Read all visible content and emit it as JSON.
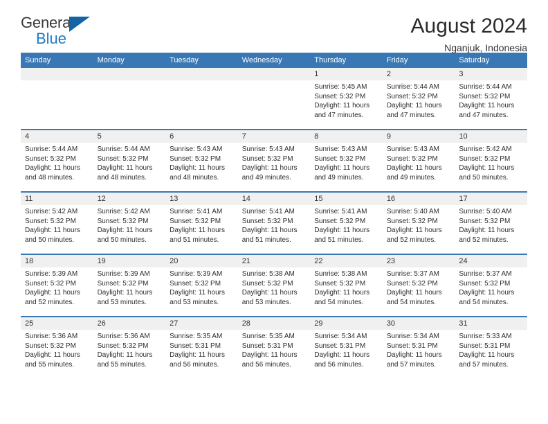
{
  "brand": {
    "name_top": "General",
    "name_bottom": "Blue",
    "accent_color": "#1464a5",
    "blue_text_color": "#1e7ac4"
  },
  "header": {
    "title": "August 2024",
    "location": "Nganjuk, Indonesia",
    "header_bg": "#3a78b5",
    "daynum_bg": "#f0f0f0"
  },
  "weekday_headers": [
    "Sunday",
    "Monday",
    "Tuesday",
    "Wednesday",
    "Thursday",
    "Friday",
    "Saturday"
  ],
  "calendar": {
    "weeks": [
      [
        {
          "day": "",
          "empty": true,
          "sunrise": "",
          "sunset": "",
          "daylight1": "",
          "daylight2": ""
        },
        {
          "day": "",
          "empty": true,
          "sunrise": "",
          "sunset": "",
          "daylight1": "",
          "daylight2": ""
        },
        {
          "day": "",
          "empty": true,
          "sunrise": "",
          "sunset": "",
          "daylight1": "",
          "daylight2": ""
        },
        {
          "day": "",
          "empty": true,
          "sunrise": "",
          "sunset": "",
          "daylight1": "",
          "daylight2": ""
        },
        {
          "day": "1",
          "empty": false,
          "sunrise": "Sunrise: 5:45 AM",
          "sunset": "Sunset: 5:32 PM",
          "daylight1": "Daylight: 11 hours",
          "daylight2": "and 47 minutes."
        },
        {
          "day": "2",
          "empty": false,
          "sunrise": "Sunrise: 5:44 AM",
          "sunset": "Sunset: 5:32 PM",
          "daylight1": "Daylight: 11 hours",
          "daylight2": "and 47 minutes."
        },
        {
          "day": "3",
          "empty": false,
          "sunrise": "Sunrise: 5:44 AM",
          "sunset": "Sunset: 5:32 PM",
          "daylight1": "Daylight: 11 hours",
          "daylight2": "and 47 minutes."
        }
      ],
      [
        {
          "day": "4",
          "empty": false,
          "sunrise": "Sunrise: 5:44 AM",
          "sunset": "Sunset: 5:32 PM",
          "daylight1": "Daylight: 11 hours",
          "daylight2": "and 48 minutes."
        },
        {
          "day": "5",
          "empty": false,
          "sunrise": "Sunrise: 5:44 AM",
          "sunset": "Sunset: 5:32 PM",
          "daylight1": "Daylight: 11 hours",
          "daylight2": "and 48 minutes."
        },
        {
          "day": "6",
          "empty": false,
          "sunrise": "Sunrise: 5:43 AM",
          "sunset": "Sunset: 5:32 PM",
          "daylight1": "Daylight: 11 hours",
          "daylight2": "and 48 minutes."
        },
        {
          "day": "7",
          "empty": false,
          "sunrise": "Sunrise: 5:43 AM",
          "sunset": "Sunset: 5:32 PM",
          "daylight1": "Daylight: 11 hours",
          "daylight2": "and 49 minutes."
        },
        {
          "day": "8",
          "empty": false,
          "sunrise": "Sunrise: 5:43 AM",
          "sunset": "Sunset: 5:32 PM",
          "daylight1": "Daylight: 11 hours",
          "daylight2": "and 49 minutes."
        },
        {
          "day": "9",
          "empty": false,
          "sunrise": "Sunrise: 5:43 AM",
          "sunset": "Sunset: 5:32 PM",
          "daylight1": "Daylight: 11 hours",
          "daylight2": "and 49 minutes."
        },
        {
          "day": "10",
          "empty": false,
          "sunrise": "Sunrise: 5:42 AM",
          "sunset": "Sunset: 5:32 PM",
          "daylight1": "Daylight: 11 hours",
          "daylight2": "and 50 minutes."
        }
      ],
      [
        {
          "day": "11",
          "empty": false,
          "sunrise": "Sunrise: 5:42 AM",
          "sunset": "Sunset: 5:32 PM",
          "daylight1": "Daylight: 11 hours",
          "daylight2": "and 50 minutes."
        },
        {
          "day": "12",
          "empty": false,
          "sunrise": "Sunrise: 5:42 AM",
          "sunset": "Sunset: 5:32 PM",
          "daylight1": "Daylight: 11 hours",
          "daylight2": "and 50 minutes."
        },
        {
          "day": "13",
          "empty": false,
          "sunrise": "Sunrise: 5:41 AM",
          "sunset": "Sunset: 5:32 PM",
          "daylight1": "Daylight: 11 hours",
          "daylight2": "and 51 minutes."
        },
        {
          "day": "14",
          "empty": false,
          "sunrise": "Sunrise: 5:41 AM",
          "sunset": "Sunset: 5:32 PM",
          "daylight1": "Daylight: 11 hours",
          "daylight2": "and 51 minutes."
        },
        {
          "day": "15",
          "empty": false,
          "sunrise": "Sunrise: 5:41 AM",
          "sunset": "Sunset: 5:32 PM",
          "daylight1": "Daylight: 11 hours",
          "daylight2": "and 51 minutes."
        },
        {
          "day": "16",
          "empty": false,
          "sunrise": "Sunrise: 5:40 AM",
          "sunset": "Sunset: 5:32 PM",
          "daylight1": "Daylight: 11 hours",
          "daylight2": "and 52 minutes."
        },
        {
          "day": "17",
          "empty": false,
          "sunrise": "Sunrise: 5:40 AM",
          "sunset": "Sunset: 5:32 PM",
          "daylight1": "Daylight: 11 hours",
          "daylight2": "and 52 minutes."
        }
      ],
      [
        {
          "day": "18",
          "empty": false,
          "sunrise": "Sunrise: 5:39 AM",
          "sunset": "Sunset: 5:32 PM",
          "daylight1": "Daylight: 11 hours",
          "daylight2": "and 52 minutes."
        },
        {
          "day": "19",
          "empty": false,
          "sunrise": "Sunrise: 5:39 AM",
          "sunset": "Sunset: 5:32 PM",
          "daylight1": "Daylight: 11 hours",
          "daylight2": "and 53 minutes."
        },
        {
          "day": "20",
          "empty": false,
          "sunrise": "Sunrise: 5:39 AM",
          "sunset": "Sunset: 5:32 PM",
          "daylight1": "Daylight: 11 hours",
          "daylight2": "and 53 minutes."
        },
        {
          "day": "21",
          "empty": false,
          "sunrise": "Sunrise: 5:38 AM",
          "sunset": "Sunset: 5:32 PM",
          "daylight1": "Daylight: 11 hours",
          "daylight2": "and 53 minutes."
        },
        {
          "day": "22",
          "empty": false,
          "sunrise": "Sunrise: 5:38 AM",
          "sunset": "Sunset: 5:32 PM",
          "daylight1": "Daylight: 11 hours",
          "daylight2": "and 54 minutes."
        },
        {
          "day": "23",
          "empty": false,
          "sunrise": "Sunrise: 5:37 AM",
          "sunset": "Sunset: 5:32 PM",
          "daylight1": "Daylight: 11 hours",
          "daylight2": "and 54 minutes."
        },
        {
          "day": "24",
          "empty": false,
          "sunrise": "Sunrise: 5:37 AM",
          "sunset": "Sunset: 5:32 PM",
          "daylight1": "Daylight: 11 hours",
          "daylight2": "and 54 minutes."
        }
      ],
      [
        {
          "day": "25",
          "empty": false,
          "sunrise": "Sunrise: 5:36 AM",
          "sunset": "Sunset: 5:32 PM",
          "daylight1": "Daylight: 11 hours",
          "daylight2": "and 55 minutes."
        },
        {
          "day": "26",
          "empty": false,
          "sunrise": "Sunrise: 5:36 AM",
          "sunset": "Sunset: 5:32 PM",
          "daylight1": "Daylight: 11 hours",
          "daylight2": "and 55 minutes."
        },
        {
          "day": "27",
          "empty": false,
          "sunrise": "Sunrise: 5:35 AM",
          "sunset": "Sunset: 5:31 PM",
          "daylight1": "Daylight: 11 hours",
          "daylight2": "and 56 minutes."
        },
        {
          "day": "28",
          "empty": false,
          "sunrise": "Sunrise: 5:35 AM",
          "sunset": "Sunset: 5:31 PM",
          "daylight1": "Daylight: 11 hours",
          "daylight2": "and 56 minutes."
        },
        {
          "day": "29",
          "empty": false,
          "sunrise": "Sunrise: 5:34 AM",
          "sunset": "Sunset: 5:31 PM",
          "daylight1": "Daylight: 11 hours",
          "daylight2": "and 56 minutes."
        },
        {
          "day": "30",
          "empty": false,
          "sunrise": "Sunrise: 5:34 AM",
          "sunset": "Sunset: 5:31 PM",
          "daylight1": "Daylight: 11 hours",
          "daylight2": "and 57 minutes."
        },
        {
          "day": "31",
          "empty": false,
          "sunrise": "Sunrise: 5:33 AM",
          "sunset": "Sunset: 5:31 PM",
          "daylight1": "Daylight: 11 hours",
          "daylight2": "and 57 minutes."
        }
      ]
    ]
  }
}
